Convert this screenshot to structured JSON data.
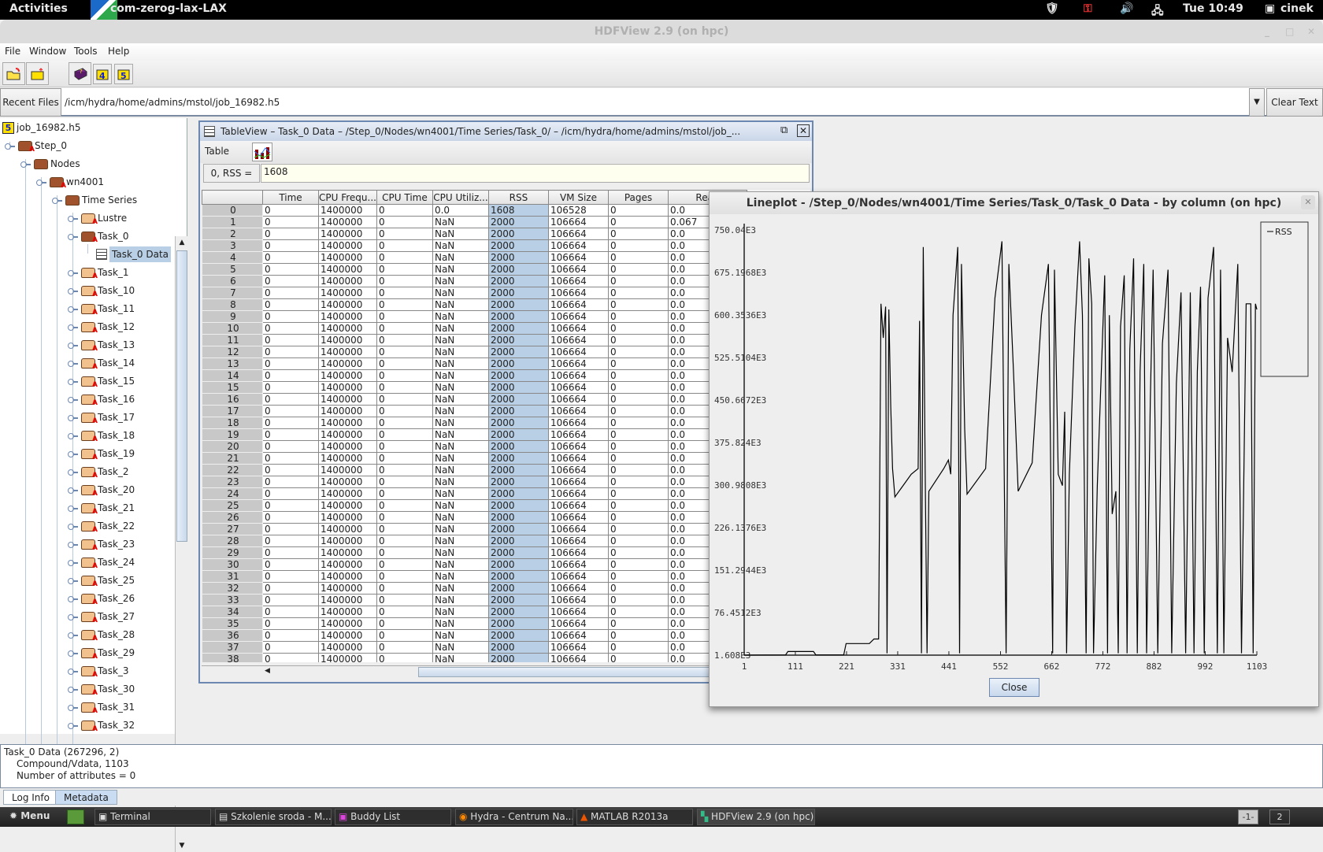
{
  "topbar": {
    "activities": "Activities",
    "app_title": "com-zerog-lax-LAX",
    "clock": "Tue 10:49",
    "user": "cinek"
  },
  "window": {
    "title": "HDFView 2.9 (on hpc)"
  },
  "menubar": [
    "File",
    "Window",
    "Tools",
    "Help"
  ],
  "toolbar": {
    "buttons": [
      "open-file-icon",
      "close-file-icon",
      "help-book-icon",
      "hdf4-library-icon",
      "hdf5-library-icon"
    ]
  },
  "recent": {
    "label": "Recent Files",
    "path": "/icm/hydra/home/admins/mstol/job_16982.h5",
    "clear": "Clear Text"
  },
  "tree": {
    "root": "job_16982.h5",
    "step": "Step_0",
    "nodes": "Nodes",
    "host": "wn4001",
    "series": "Time Series",
    "lustre": "Lustre",
    "task0": "Task_0",
    "task0data": "Task_0 Data",
    "tasks": [
      "Task_1",
      "Task_10",
      "Task_11",
      "Task_12",
      "Task_13",
      "Task_14",
      "Task_15",
      "Task_16",
      "Task_17",
      "Task_18",
      "Task_19",
      "Task_2",
      "Task_20",
      "Task_21",
      "Task_22",
      "Task_23",
      "Task_24",
      "Task_25",
      "Task_26",
      "Task_27",
      "Task_28",
      "Task_29",
      "Task_3",
      "Task_30",
      "Task_31",
      "Task_32"
    ]
  },
  "tableview": {
    "title": "TableView  –  Task_0 Data  –  /Step_0/Nodes/wn4001/Time Series/Task_0/  –  /icm/hydra/home/admins/mstol/job_...",
    "menu": "Table",
    "cell_label": "0, RSS  =",
    "cell_value": "1608",
    "columns": [
      "",
      "Time",
      "CPU Frequ...",
      "CPU Time",
      "CPU Utiliz...",
      "RSS",
      "VM Size",
      "Pages",
      "Read"
    ],
    "first_row": [
      "0",
      "0",
      "1400000",
      "0",
      "0.0",
      "1608",
      "106528",
      "0",
      "0.0"
    ],
    "row1": [
      "1",
      "0",
      "1400000",
      "0",
      "NaN",
      "2000",
      "106664",
      "0",
      "0.067"
    ],
    "repeat_row": [
      "0",
      "1400000",
      "0",
      "NaN",
      "2000",
      "106664",
      "0",
      "0.0"
    ],
    "row_count_visible": 39
  },
  "lineplot": {
    "title": "Lineplot - /Step_0/Nodes/wn4001/Time Series/Task_0/Task_0 Data - by column (on hpc)",
    "close": "Close"
  },
  "chart_data": {
    "type": "line",
    "title": "Lineplot - /Step_0/Nodes/wn4001/Time Series/Task_0/Task_0 Data - by column (on hpc)",
    "xlabel": "",
    "ylabel": "",
    "legend": [
      "RSS"
    ],
    "legend_position": "top-right",
    "xlim": [
      1,
      1103
    ],
    "ylim": [
      1608,
      750040
    ],
    "x_ticks": [
      "1",
      "111",
      "221",
      "331",
      "441",
      "552",
      "662",
      "772",
      "882",
      "992",
      "1103"
    ],
    "y_ticks": [
      "1.608E3",
      "76.4512E3",
      "151.2944E3",
      "226.1376E3",
      "300.9808E3",
      "375.824E3",
      "450.6672E3",
      "525.5104E3",
      "600.3536E3",
      "675.1968E3",
      "750.04E3"
    ],
    "series": [
      {
        "name": "RSS",
        "points": [
          [
            1,
            1608
          ],
          [
            90,
            2000
          ],
          [
            95,
            8000
          ],
          [
            150,
            8000
          ],
          [
            155,
            2000
          ],
          [
            215,
            2000
          ],
          [
            220,
            22000
          ],
          [
            270,
            22000
          ],
          [
            280,
            30000
          ],
          [
            290,
            30000
          ],
          [
            295,
            620000
          ],
          [
            300,
            560000
          ],
          [
            305,
            615000
          ],
          [
            308,
            5000
          ],
          [
            312,
            610000
          ],
          [
            316,
            440000
          ],
          [
            320,
            330000
          ],
          [
            325,
            280000
          ],
          [
            360,
            320000
          ],
          [
            375,
            330000
          ],
          [
            378,
            590000
          ],
          [
            382,
            5000
          ],
          [
            386,
            720000
          ],
          [
            390,
            330000
          ],
          [
            394,
            5000
          ],
          [
            398,
            290000
          ],
          [
            430,
            330000
          ],
          [
            440,
            345000
          ],
          [
            445,
            320000
          ],
          [
            450,
            600000
          ],
          [
            460,
            720000
          ],
          [
            464,
            5000
          ],
          [
            468,
            690000
          ],
          [
            475,
            400000
          ],
          [
            480,
            285000
          ],
          [
            520,
            330000
          ],
          [
            540,
            630000
          ],
          [
            555,
            730000
          ],
          [
            560,
            320000
          ],
          [
            564,
            5000
          ],
          [
            570,
            690000
          ],
          [
            580,
            500000
          ],
          [
            590,
            290000
          ],
          [
            620,
            340000
          ],
          [
            640,
            600000
          ],
          [
            655,
            690000
          ],
          [
            660,
            320000
          ],
          [
            664,
            5000
          ],
          [
            668,
            680000
          ],
          [
            676,
            320000
          ],
          [
            685,
            300000
          ],
          [
            690,
            430000
          ],
          [
            694,
            5000
          ],
          [
            700,
            320000
          ],
          [
            712,
            580000
          ],
          [
            722,
            730000
          ],
          [
            728,
            600000
          ],
          [
            732,
            320000
          ],
          [
            736,
            5000
          ],
          [
            742,
            700000
          ],
          [
            748,
            620000
          ],
          [
            752,
            5000
          ],
          [
            760,
            300000
          ],
          [
            776,
            670000
          ],
          [
            782,
            5000
          ],
          [
            786,
            600000
          ],
          [
            792,
            250000
          ],
          [
            800,
            290000
          ],
          [
            805,
            5000
          ],
          [
            810,
            580000
          ],
          [
            818,
            670000
          ],
          [
            824,
            5000
          ],
          [
            830,
            540000
          ],
          [
            838,
            700000
          ],
          [
            846,
            5000
          ],
          [
            852,
            500000
          ],
          [
            860,
            690000
          ],
          [
            866,
            5000
          ],
          [
            874,
            450000
          ],
          [
            880,
            680000
          ],
          [
            890,
            5000
          ],
          [
            900,
            550000
          ],
          [
            912,
            680000
          ],
          [
            920,
            5000
          ],
          [
            930,
            480000
          ],
          [
            940,
            640000
          ],
          [
            950,
            5000
          ],
          [
            960,
            640000
          ],
          [
            968,
            5000
          ],
          [
            975,
            500000
          ],
          [
            982,
            650000
          ],
          [
            990,
            5000
          ],
          [
            998,
            630000
          ],
          [
            1010,
            720000
          ],
          [
            1018,
            5000
          ],
          [
            1025,
            680000
          ],
          [
            1032,
            5000
          ],
          [
            1040,
            560000
          ],
          [
            1050,
            500000
          ],
          [
            1062,
            690000
          ],
          [
            1070,
            5000
          ],
          [
            1080,
            620000
          ],
          [
            1090,
            620000
          ],
          [
            1095,
            5000
          ],
          [
            1100,
            620000
          ],
          [
            1103,
            610000
          ]
        ]
      }
    ]
  },
  "status": {
    "line1": "Task_0 Data (267296, 2)",
    "line2": "Compound/Vdata,     1103",
    "line3": "Number of attributes = 0"
  },
  "tabs": [
    "Log Info",
    "Metadata"
  ],
  "taskbar": {
    "menu": "Menu",
    "tasks": [
      "Terminal",
      "Szkolenie sroda - M...",
      "Buddy List",
      "Hydra - Centrum Na...",
      "MATLAB R2013a",
      "HDFView 2.9 (on hpc)"
    ],
    "workspaces": [
      "-1-",
      "2"
    ]
  }
}
